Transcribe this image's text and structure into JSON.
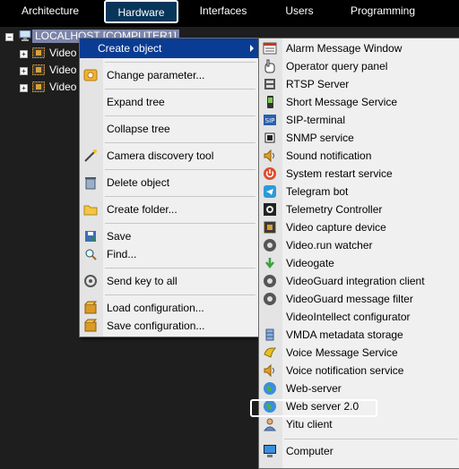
{
  "topbar": {
    "tabs": [
      {
        "label": "Architecture"
      },
      {
        "label": "Hardware",
        "active": true
      },
      {
        "label": "Interfaces"
      },
      {
        "label": "Users"
      },
      {
        "label": "Programming"
      }
    ]
  },
  "tree": {
    "root": {
      "label": "LOCALHOST [COMPUTER1]",
      "expander": "−"
    },
    "children": [
      {
        "label": "Video",
        "expander": "+"
      },
      {
        "label": "Video",
        "expander": "+"
      },
      {
        "label": "Video",
        "expander": "+"
      }
    ]
  },
  "context_menu": {
    "items": [
      {
        "label": "Create object",
        "icon": "none",
        "highlighted": true,
        "submenu": true
      },
      {
        "label": "Change parameter...",
        "icon": "gear-icon"
      },
      {
        "label": "Expand tree",
        "icon": "none"
      },
      {
        "label": "Collapse tree",
        "icon": "none"
      },
      {
        "label": "Camera discovery tool",
        "icon": "wand-icon"
      },
      {
        "label": "Delete object",
        "icon": "trash-icon"
      },
      {
        "label": "Create folder...",
        "icon": "folder-icon"
      },
      {
        "label": "Save",
        "icon": "save-icon"
      },
      {
        "label": "Find...",
        "icon": "magnifier-icon"
      },
      {
        "label": "Send key to all",
        "icon": "key-icon"
      },
      {
        "label": "Load configuration...",
        "icon": "box-icon"
      },
      {
        "label": "Save configuration...",
        "icon": "box-icon"
      }
    ]
  },
  "submenu": {
    "items": [
      {
        "label": "Alarm Message Window",
        "icon": "alarm-window-icon"
      },
      {
        "label": "Operator query panel",
        "icon": "hand-icon"
      },
      {
        "label": "RTSP Server",
        "icon": "rtsp-icon"
      },
      {
        "label": "Short Message Service",
        "icon": "phone-icon"
      },
      {
        "label": "SIP-terminal",
        "icon": "sip-icon"
      },
      {
        "label": "SNMP service",
        "icon": "snmp-icon"
      },
      {
        "label": "Sound notification",
        "icon": "speaker-icon"
      },
      {
        "label": "System restart service",
        "icon": "power-icon"
      },
      {
        "label": "Telegram bot",
        "icon": "telegram-icon"
      },
      {
        "label": "Telemetry Controller",
        "icon": "telemetry-icon"
      },
      {
        "label": "Video capture device",
        "icon": "capture-icon"
      },
      {
        "label": "Video.run watcher",
        "icon": "watcher-icon"
      },
      {
        "label": "Videogate",
        "icon": "videogate-icon"
      },
      {
        "label": "VideoGuard integration client",
        "icon": "watcher-icon"
      },
      {
        "label": "VideoGuard message filter",
        "icon": "watcher-icon"
      },
      {
        "label": "VideoIntellect configurator",
        "icon": "none"
      },
      {
        "label": "VMDA metadata storage",
        "icon": "storage-icon"
      },
      {
        "label": "Voice Message Service",
        "icon": "voice-icon"
      },
      {
        "label": "Voice notification service",
        "icon": "speaker-icon"
      },
      {
        "label": "Web-server",
        "icon": "globe-icon"
      },
      {
        "label": "Web server 2.0",
        "icon": "globe-icon",
        "callout": true
      },
      {
        "label": "Yitu client",
        "icon": "person-icon"
      },
      {
        "label": "Computer",
        "icon": "computer-icon"
      }
    ]
  },
  "colors": {
    "menu_highlight": "#0a3c94",
    "active_tab": "#07365a",
    "menu_bg": "#f0f0f0"
  }
}
